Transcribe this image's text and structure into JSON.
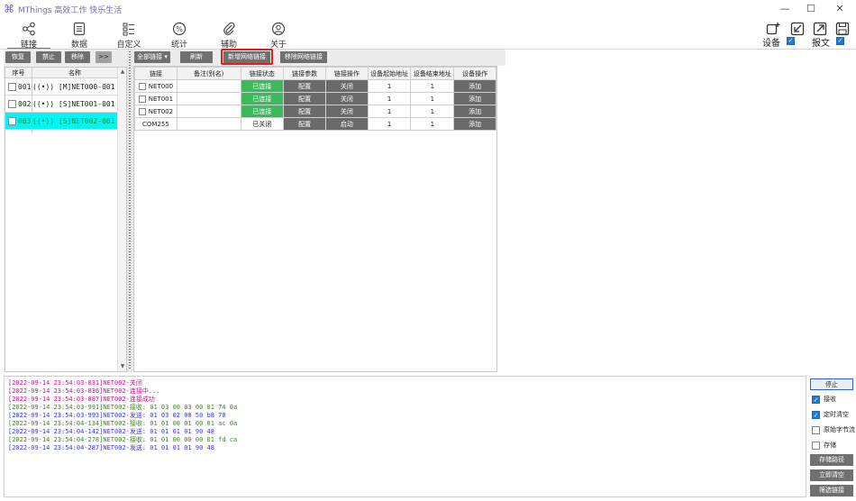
{
  "window": {
    "title": "MThings 高效工作 快乐生活"
  },
  "ribbon": {
    "tabs": [
      {
        "label": "链接",
        "icon": "share-nodes-icon"
      },
      {
        "label": "数据",
        "icon": "document-list-icon"
      },
      {
        "label": "自定义",
        "icon": "custom-grid-icon"
      },
      {
        "label": "统计",
        "icon": "percent-circle-icon"
      },
      {
        "label": "辅助",
        "icon": "paperclip-icon"
      },
      {
        "label": "关于",
        "icon": "user-circle-icon"
      }
    ],
    "device_label": "设备",
    "message_label": "报文"
  },
  "left": {
    "buttons": [
      "恢复",
      "禁止",
      "移除",
      ">>"
    ],
    "columns": [
      "序号",
      "名称"
    ],
    "rows": [
      {
        "num": "001",
        "name": "((•)) [M]NET000-001"
      },
      {
        "num": "002",
        "name": "((•)) [S]NET001-001"
      },
      {
        "num": "003",
        "name": "((•)) [S]NET002-001"
      }
    ]
  },
  "right": {
    "toolbar": {
      "all_links": "全部链接",
      "refresh": "刷新",
      "add_net": "新增网络链接",
      "remove_net": "移除网络链接"
    },
    "columns": [
      "链接",
      "备注(别名)",
      "链接状态",
      "链接参数",
      "链接操作",
      "设备起始地址",
      "设备结束地址",
      "设备操作"
    ],
    "rows": [
      {
        "link": "NET000",
        "note": "",
        "status": "已连接",
        "param": "配置",
        "op": "关闭",
        "start": "1",
        "end": "1",
        "dev": "添加"
      },
      {
        "link": "NET001",
        "note": "",
        "status": "已连接",
        "param": "配置",
        "op": "关闭",
        "start": "1",
        "end": "1",
        "dev": "添加"
      },
      {
        "link": "NET002",
        "note": "",
        "status": "已连接",
        "param": "配置",
        "op": "关闭",
        "start": "1",
        "end": "1",
        "dev": "添加"
      },
      {
        "link": "COM255",
        "note": "",
        "status": "已关闭",
        "param": "配置",
        "op": "启动",
        "start": "1",
        "end": "1",
        "dev": "添加"
      }
    ]
  },
  "log": {
    "lines": [
      {
        "ts": "[2022-09-14 23:54:03-831]",
        "msg": "NET002-关闭",
        "kind": "ts"
      },
      {
        "ts": "[2022-09-14 23:54:03-836]",
        "msg": "NET002-连接中...",
        "kind": "ts"
      },
      {
        "ts": "[2022-09-14 23:54:03-887]",
        "msg": "NET002-连接成功",
        "kind": "ts"
      },
      {
        "ts": "[2022-09-14 23:54:03-991]",
        "msg": "NET002-接收: 01 03 00 03 00 01 74 0a",
        "kind": "ts2"
      },
      {
        "ts": "[2022-09-14 23:54:03-993]",
        "msg": "NET002-发送: 01 03 02 00 50 b8 78",
        "kind": "ts3"
      },
      {
        "ts": "[2022-09-14 23:54:04-134]",
        "msg": "NET002-接收: 01 01 00 01 00 01 ac 0a",
        "kind": "ts2"
      },
      {
        "ts": "[2022-09-14 23:54:04-142]",
        "msg": "NET002-发送: 01 01 01 01 90 48",
        "kind": "ts3"
      },
      {
        "ts": "[2022-09-14 23:54:04-278]",
        "msg": "NET002-接收: 01 01 00 00 00 01 fd ca",
        "kind": "ts2"
      },
      {
        "ts": "[2022-09-14 23:54:04-287]",
        "msg": "NET002-发送: 01 01 01 01 90 48",
        "kind": "ts3"
      }
    ]
  },
  "controls": {
    "stop": "停止",
    "receive": "接收",
    "timed_clear": "定时清空",
    "raw_bytes": "原始字节流",
    "store": "存储",
    "store_path": "存储路径",
    "clear_now": "立即清空",
    "filter_link": "筛选链接"
  }
}
